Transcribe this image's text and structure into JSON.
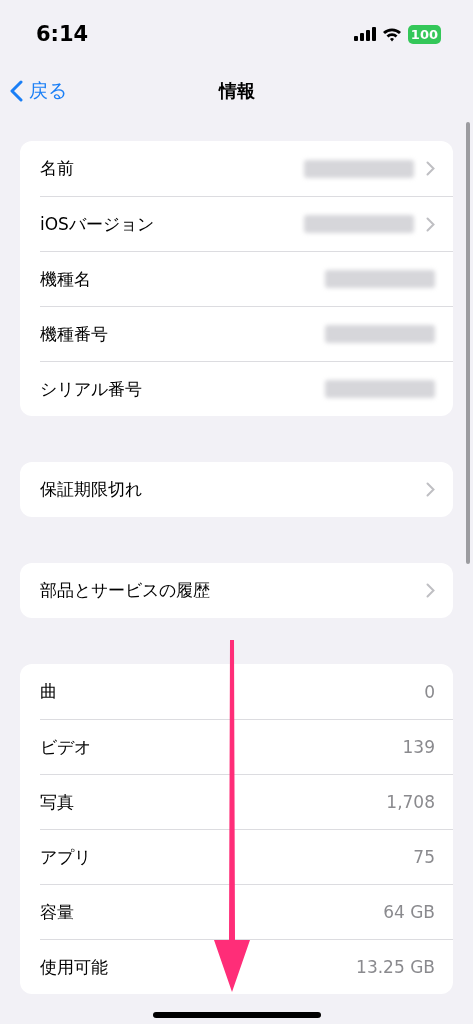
{
  "status_bar": {
    "time": "6:14",
    "battery": "100"
  },
  "nav": {
    "back": "戻る",
    "title": "情報"
  },
  "groups": [
    {
      "rows": [
        {
          "label": "名前",
          "kind": "redacted",
          "chevron": true
        },
        {
          "label": "iOSバージョン",
          "kind": "redacted",
          "chevron": true
        },
        {
          "label": "機種名",
          "kind": "redacted",
          "chevron": false
        },
        {
          "label": "機種番号",
          "kind": "redacted",
          "chevron": false
        },
        {
          "label": "シリアル番号",
          "kind": "redacted",
          "chevron": false
        }
      ]
    },
    {
      "rows": [
        {
          "label": "保証期限切れ",
          "kind": "plain",
          "chevron": true
        }
      ]
    },
    {
      "rows": [
        {
          "label": "部品とサービスの履歴",
          "kind": "plain",
          "chevron": true
        }
      ]
    },
    {
      "rows": [
        {
          "label": "曲",
          "kind": "text",
          "value": "0",
          "chevron": false
        },
        {
          "label": "ビデオ",
          "kind": "text",
          "value": "139",
          "chevron": false
        },
        {
          "label": "写真",
          "kind": "text",
          "value": "1,708",
          "chevron": false
        },
        {
          "label": "アプリ",
          "kind": "text",
          "value": "75",
          "chevron": false
        },
        {
          "label": "容量",
          "kind": "text",
          "value": "64 GB",
          "chevron": false
        },
        {
          "label": "使用可能",
          "kind": "text",
          "value": "13.25 GB",
          "chevron": false
        }
      ]
    }
  ]
}
